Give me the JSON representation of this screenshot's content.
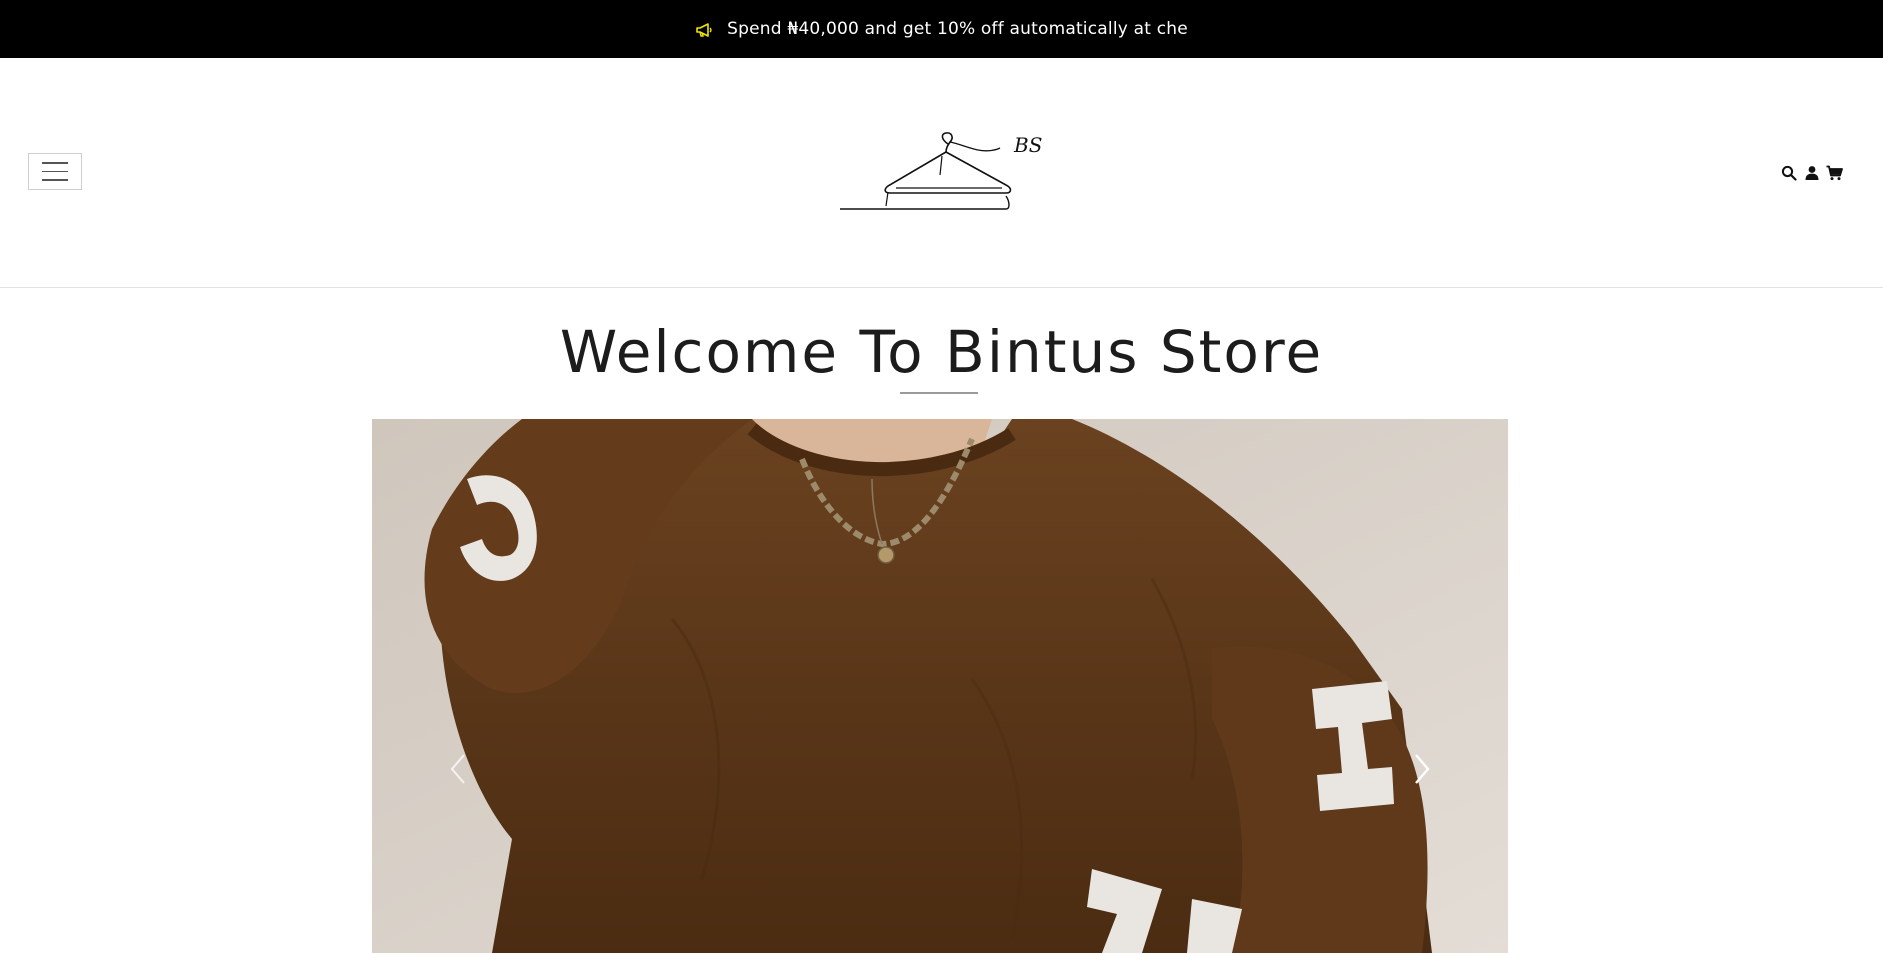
{
  "announcement": {
    "text": "Spend ₦40,000 and get 10% off automatically at che",
    "icon": "megaphone-icon",
    "icon_color": "#f2e600"
  },
  "header": {
    "menu_icon": "hamburger-menu-icon",
    "logo": {
      "text": "BS"
    },
    "icons": [
      "search-icon",
      "account-icon",
      "cart-icon"
    ]
  },
  "main": {
    "title": "Welcome To Bintus Store"
  },
  "carousel": {
    "prev_icon": "chevron-left-icon",
    "next_icon": "chevron-right-icon"
  },
  "colors": {
    "announcement_bg": "#000000",
    "sweater_brown": "#5a3618",
    "background": "#ffffff"
  }
}
